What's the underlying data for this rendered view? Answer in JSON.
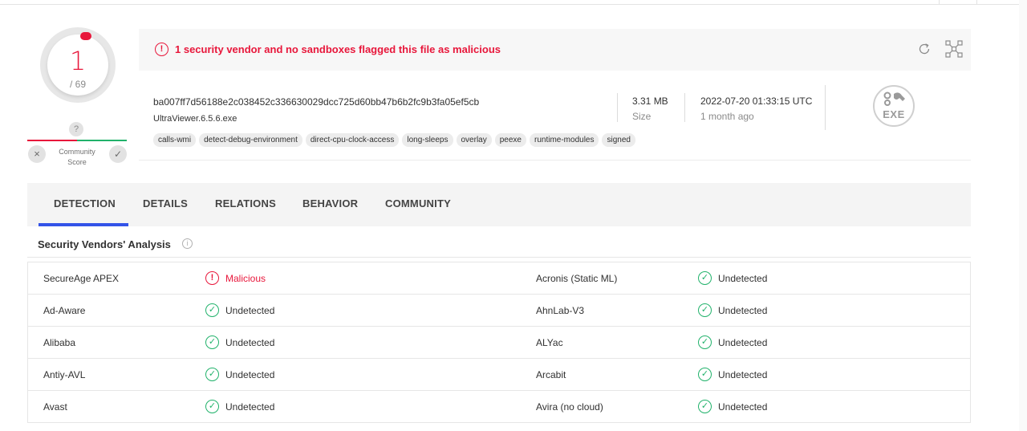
{
  "score": {
    "detections": "1",
    "total": "/ 69"
  },
  "community": {
    "unknown": "?",
    "label_line1": "Community",
    "label_line2": "Score",
    "dislike": "×",
    "like": "✓"
  },
  "alert": {
    "icon": "!",
    "text": "1 security vendor and no sandboxes flagged this file as malicious"
  },
  "file": {
    "hash": "ba007ff7d56188e2c038452c336630029dcc725d60bb47b6b2fc9b3fa05ef5cb",
    "name": "UltraViewer.6.5.6.exe",
    "tags": [
      "calls-wmi",
      "detect-debug-environment",
      "direct-cpu-clock-access",
      "long-sleeps",
      "overlay",
      "peexe",
      "runtime-modules",
      "signed"
    ],
    "size": "3.31 MB",
    "size_label": "Size",
    "date": "2022-07-20 01:33:15 UTC",
    "date_ago": "1 month ago",
    "type_label": "EXE"
  },
  "tabs": [
    "DETECTION",
    "DETAILS",
    "RELATIONS",
    "BEHAVIOR",
    "COMMUNITY"
  ],
  "active_tab": "DETECTION",
  "section": {
    "title": "Security Vendors' Analysis",
    "info_icon": "i"
  },
  "vendors": [
    {
      "left": {
        "name": "SecureAge APEX",
        "result": "Malicious",
        "status": "malicious"
      },
      "right": {
        "name": "Acronis (Static ML)",
        "result": "Undetected",
        "status": "undetected"
      }
    },
    {
      "left": {
        "name": "Ad-Aware",
        "result": "Undetected",
        "status": "undetected"
      },
      "right": {
        "name": "AhnLab-V3",
        "result": "Undetected",
        "status": "undetected"
      }
    },
    {
      "left": {
        "name": "Alibaba",
        "result": "Undetected",
        "status": "undetected"
      },
      "right": {
        "name": "ALYac",
        "result": "Undetected",
        "status": "undetected"
      }
    },
    {
      "left": {
        "name": "Antiy-AVL",
        "result": "Undetected",
        "status": "undetected"
      },
      "right": {
        "name": "Arcabit",
        "result": "Undetected",
        "status": "undetected"
      }
    },
    {
      "left": {
        "name": "Avast",
        "result": "Undetected",
        "status": "undetected"
      },
      "right": {
        "name": "Avira (no cloud)",
        "result": "Undetected",
        "status": "undetected"
      }
    }
  ],
  "colors": {
    "malicious": "#e8173b",
    "undetected": "#21b26b",
    "accent": "#3353e8"
  }
}
